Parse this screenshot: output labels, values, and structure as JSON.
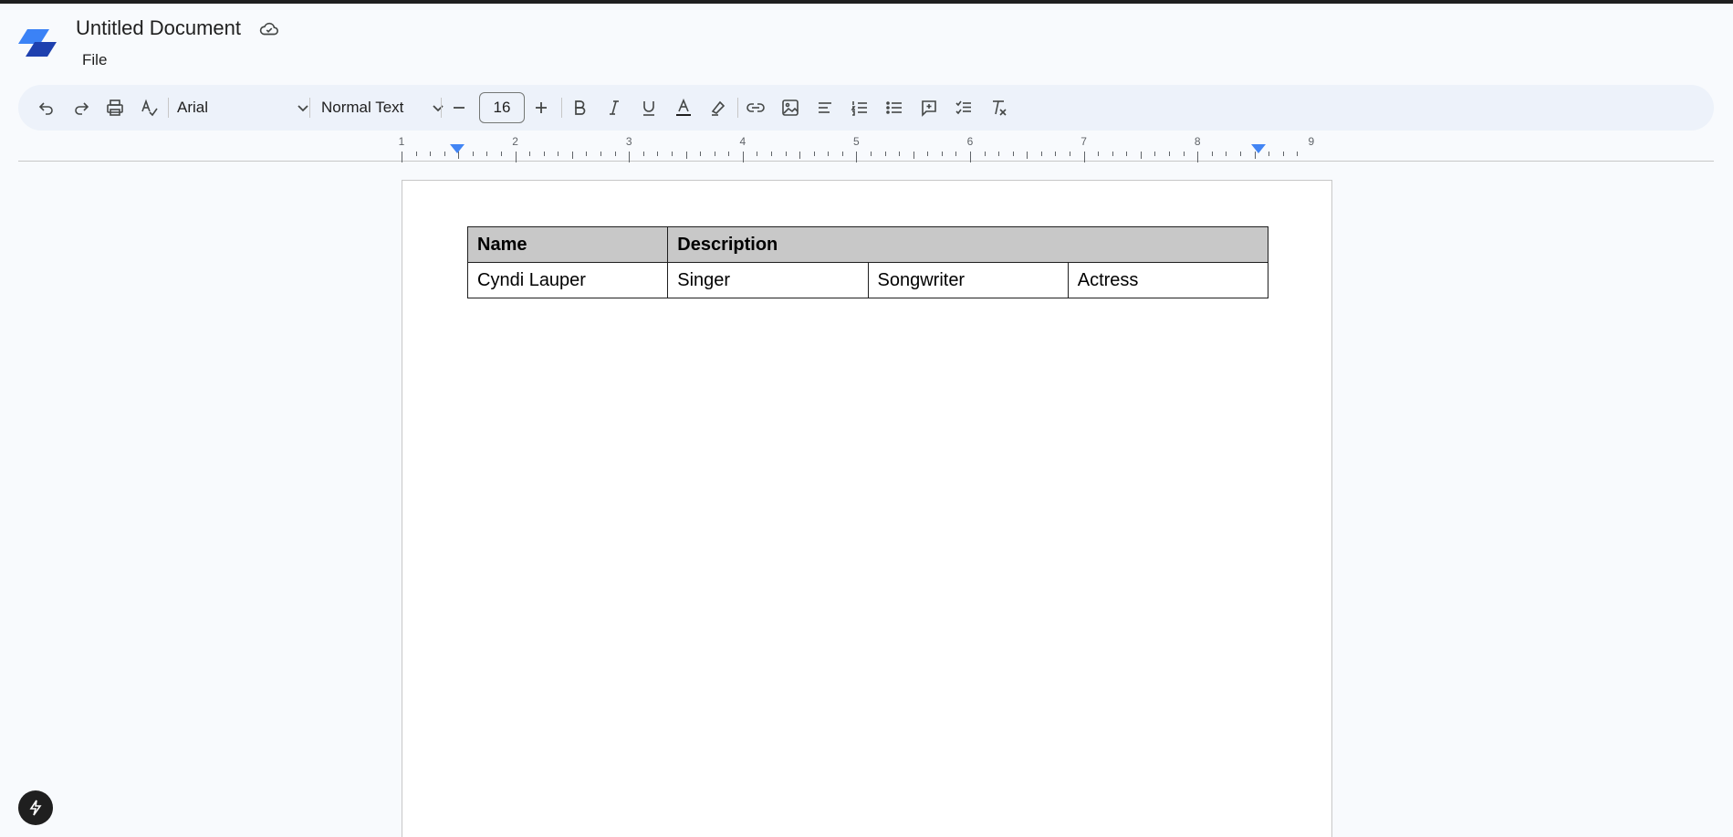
{
  "app": {
    "logo_icon": "app-logo-icon",
    "document_title": "Untitled Document",
    "save_status_icon": "cloud-saved-icon"
  },
  "menu": {
    "file_label": "File"
  },
  "toolbar": {
    "font_family": "Arial",
    "paragraph_style": "Normal Text",
    "font_size": "16",
    "icons": [
      "undo-icon",
      "redo-icon",
      "print-icon",
      "spellcheck-icon",
      "decrease-size-icon",
      "increase-size-icon",
      "bold-icon",
      "italic-icon",
      "underline-icon",
      "text-color-icon",
      "highlight-icon",
      "link-icon",
      "image-icon",
      "align-icon",
      "numbered-list-icon",
      "bulleted-list-icon",
      "comment-icon",
      "checklist-icon",
      "clear-format-icon"
    ]
  },
  "ruler": {
    "numbers": [
      "1",
      "2",
      "3",
      "4",
      "5",
      "6",
      "7",
      "8",
      "9"
    ]
  },
  "table": {
    "header": {
      "name": "Name",
      "description": "Description"
    },
    "rows": [
      {
        "name": "Cyndi Lauper",
        "d1": "Singer",
        "d2": "Songwriter",
        "d3": "Actress"
      }
    ]
  },
  "colors": {
    "accent": "#4285f4",
    "toolbar_bg": "#edf2fa",
    "header_cell_bg": "#c8c8c8"
  }
}
